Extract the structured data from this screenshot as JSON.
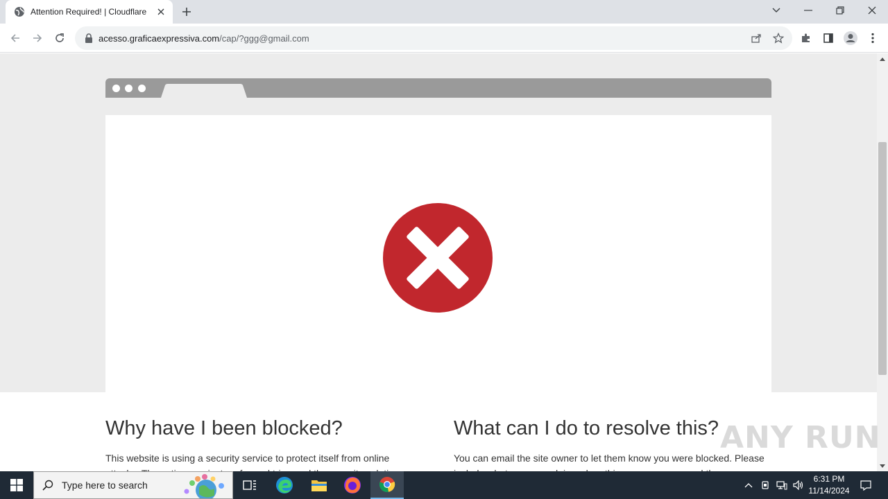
{
  "browser": {
    "tab_title": "Attention Required! | Cloudflare",
    "url_host": "acesso.graficaexpressiva.com",
    "url_path": "/cap/?ggg@gmail.com"
  },
  "page": {
    "heading_blocked": "Why have I been blocked?",
    "text_blocked": "This website is using a security service to protect itself from online attacks. The action you just performed triggered the security solution.",
    "heading_resolve": "What can I do to resolve this?",
    "text_resolve": "You can email the site owner to let them know you were blocked. Please include what you were doing when this page came up and the"
  },
  "watermark": "ANY RUN",
  "taskbar": {
    "search_placeholder": "Type here to search",
    "time": "6:31 PM",
    "date": "11/14/2024"
  },
  "colors": {
    "error_red": "#c1272d",
    "tab_strip": "#dee1e6",
    "taskbar": "#1f2a36"
  }
}
